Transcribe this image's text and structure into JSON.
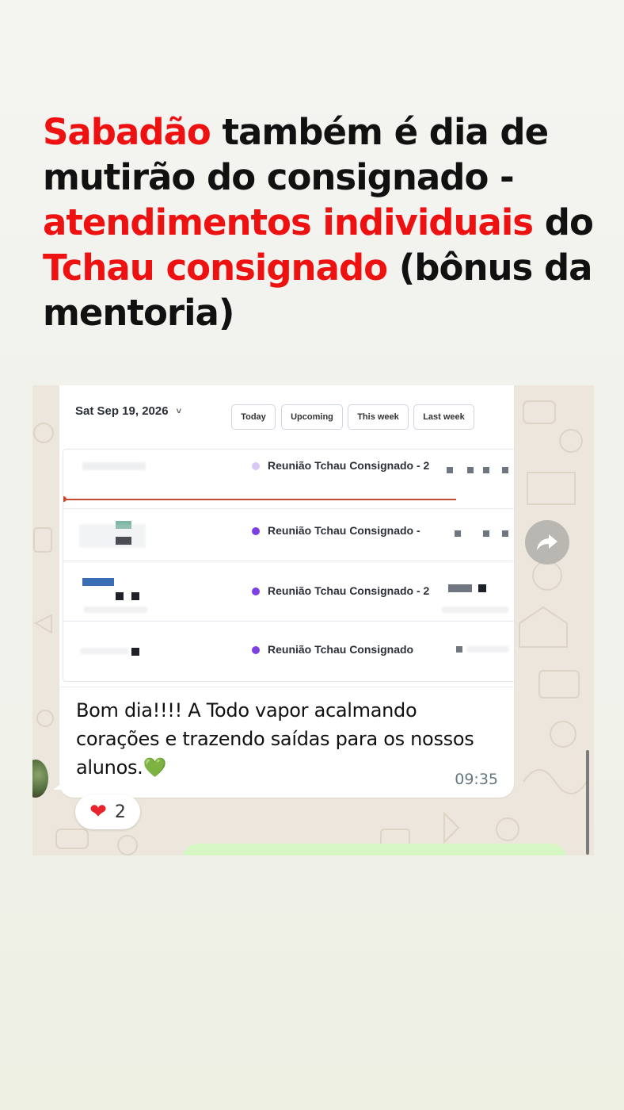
{
  "headline": {
    "part1_red": "Sabadão",
    "part1_black": " também é dia de mutirão do consignado - ",
    "part2_red": "atendimentos individuais",
    "part3_black": " do ",
    "part4_red": "Tchau consignado",
    "part5_black": " (bônus da mentoria)"
  },
  "calendar": {
    "date_label": "Sat Sep 19, 2026",
    "chevron": "˅",
    "filters": [
      "Today",
      "Upcoming",
      "This week",
      "Last week"
    ],
    "events": [
      {
        "title": "Reunião Tchau Consignado - 2",
        "dot": "light"
      },
      {
        "title": "Reunião Tchau Consignado -",
        "dot": "purple"
      },
      {
        "title": "Reunião Tchau Consignado - 2",
        "dot": "purple"
      },
      {
        "title": "Reunião Tchau Consignado",
        "dot": "purple"
      }
    ]
  },
  "message": {
    "text": "Bom dia!!!! A Todo vapor acalmando corações e trazendo saídas para os nossos alunos.",
    "emoji": "💚",
    "time": "09:35"
  },
  "reaction": {
    "emoji": "❤",
    "count": "2"
  },
  "icons": {
    "forward": "forward-icon",
    "reaction": "heart-icon"
  },
  "colors": {
    "accent_red": "#ee1111",
    "event_purple": "#7b3fe4",
    "now_line": "#c64a2c"
  }
}
